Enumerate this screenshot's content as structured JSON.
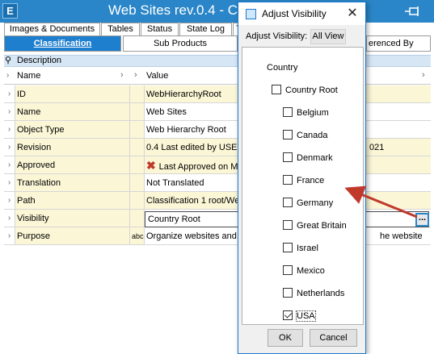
{
  "window": {
    "title": "Web Sites rev.0.4 - Cl",
    "app_icon": "E"
  },
  "tabs_row1": [
    {
      "label": "Images & Documents"
    },
    {
      "label": "Tables"
    },
    {
      "label": "Status"
    },
    {
      "label": "State Log"
    },
    {
      "label": "Ta"
    }
  ],
  "tabs_row2": [
    {
      "label": "Classification",
      "active": true
    },
    {
      "label": "Sub Products",
      "active": false
    },
    {
      "label": "erenced By",
      "active": false
    }
  ],
  "grid": {
    "section_header": "Description",
    "columns": {
      "name": "Name",
      "value": "Value"
    },
    "rows": [
      {
        "name": "ID",
        "mid": "",
        "value": "WebHierarchyRoot",
        "yellow": true
      },
      {
        "name": "Name",
        "mid": "",
        "value": "Web Sites",
        "yellow": false
      },
      {
        "name": "Object Type",
        "mid": "",
        "value": "Web Hierarchy Root",
        "yellow": false
      },
      {
        "name": "Revision",
        "mid": "",
        "value": "0.4 Last edited by USER",
        "value_tail": "021",
        "yellow": true
      },
      {
        "name": "Approved",
        "mid": "",
        "value": "Last Approved on M",
        "yellow": true
      },
      {
        "name": "Translation",
        "mid": "",
        "value": "Not Translated",
        "yellow": false
      },
      {
        "name": "Path",
        "mid": "",
        "value": "Classification 1 root/We",
        "yellow": true
      },
      {
        "name": "Visibility",
        "mid": "",
        "value": "Country Root",
        "yellow": false
      },
      {
        "name": "Purpose",
        "mid": "abc",
        "value": "Organize websites and c",
        "value_tail": "he website",
        "yellow": false
      }
    ],
    "ellipsis_label": "..."
  },
  "dialog": {
    "title": "Adjust Visibility",
    "close_label": "✕",
    "toolbar_label": "Adjust Visibility:",
    "toolbar_button": "All View",
    "tree": {
      "root_label": "Country",
      "parent": {
        "label": "Country Root",
        "checked": false
      },
      "children": [
        {
          "label": "Belgium",
          "checked": false
        },
        {
          "label": "Canada",
          "checked": false
        },
        {
          "label": "Denmark",
          "checked": false
        },
        {
          "label": "France",
          "checked": false
        },
        {
          "label": "Germany",
          "checked": false
        },
        {
          "label": "Great Britain",
          "checked": false
        },
        {
          "label": "Israel",
          "checked": false
        },
        {
          "label": "Mexico",
          "checked": false
        },
        {
          "label": "Netherlands",
          "checked": false
        },
        {
          "label": "USA",
          "checked": true
        }
      ]
    },
    "ok_label": "OK",
    "cancel_label": "Cancel"
  },
  "colors": {
    "titlebar": "#2a86c8",
    "active_tab": "#1f7fcf",
    "yellow_cell": "#fbf6d6",
    "arrow": "#c0392b"
  }
}
